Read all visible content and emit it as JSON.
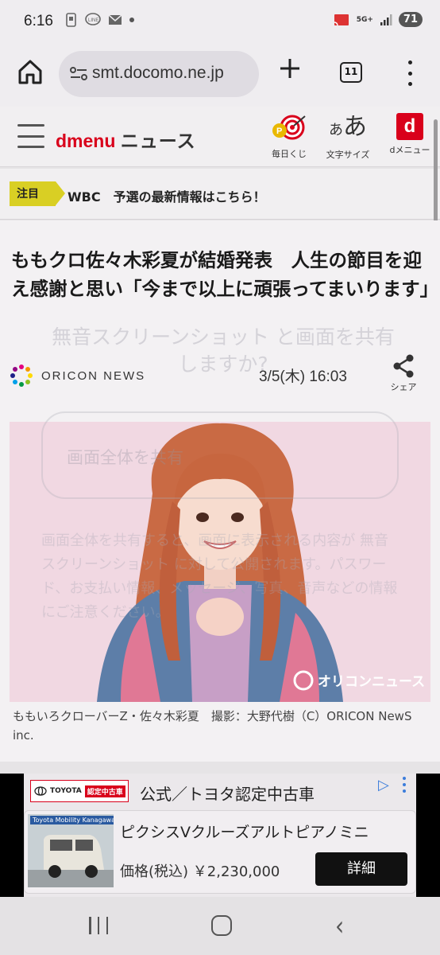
{
  "status_bar": {
    "time": "6:16",
    "battery": "71",
    "network": "5G+"
  },
  "browser": {
    "url": "smt.docomo.ne.jp",
    "tab_count": "11"
  },
  "site_header": {
    "logo_brand": "dmenu",
    "logo_section": "ニュース",
    "buttons": [
      {
        "label": "毎日くじ",
        "icon": "lottery-icon"
      },
      {
        "label": "文字サイズ",
        "icon": "font-size-icon",
        "glyph": "あ"
      },
      {
        "label": "dメニュー",
        "icon": "dmenu-icon",
        "glyph": "d"
      }
    ]
  },
  "notice": {
    "badge": "注目",
    "text": "WBC　予選の最新情報はこちら！"
  },
  "article": {
    "headline": "ももクロ佐々木彩夏が結婚発表　人生の節目を迎え感謝と思い「今まで以上に頑張ってまいります」",
    "source": "ORICON NEWS",
    "date": "3/5(木) 16:03",
    "share_label": "シェア",
    "photo_watermark": "オリコンニュース",
    "caption": "ももいろクローバーZ・佐々木彩夏　撮影：大野代樹（C）ORICON NewS inc."
  },
  "overlay_dialog": {
    "title": "無音スクリーンショット と画面を共有しますか?",
    "select_value": "画面全体を共有",
    "body": "画面全体を共有すると、画面に表示される内容が 無音スクリーンショット に対して公開されます。パスワード、お支払い情報、メッセージ、写真、音声などの情報にご注意ください。"
  },
  "ad": {
    "brand_logo": "TOYOTA",
    "brand_sub": "認定中古車",
    "headline": "公式／トヨタ認定中古車",
    "dealer_label": "Toyota Mobility Kanagawa",
    "car_title": "ピクシスVクルーズアルトピアノミニ",
    "price": "価格(税込) ￥2,230,000",
    "cta": "詳細"
  },
  "colors": {
    "brand_red": "#d9001b",
    "notice_yellow": "#d9cf24",
    "photo_pink": "#f0d6e0"
  }
}
